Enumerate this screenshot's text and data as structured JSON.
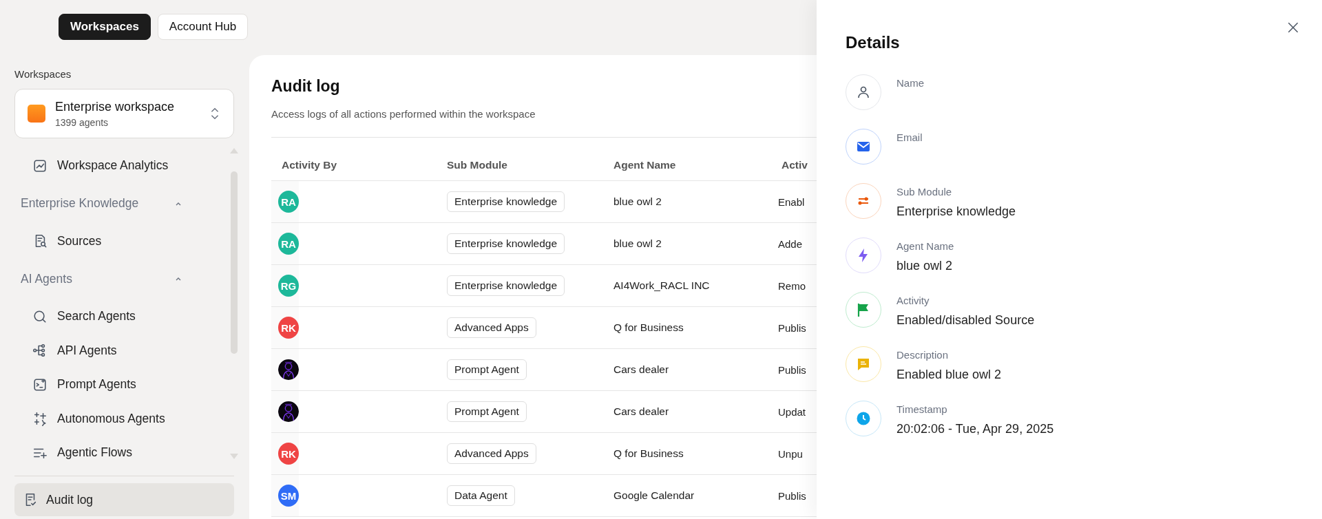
{
  "top_tabs": [
    {
      "label": "Workspaces",
      "selected": true
    },
    {
      "label": "Account Hub",
      "selected": false
    }
  ],
  "sidebar": {
    "section_label": "Workspaces",
    "workspace": {
      "name": "Enterprise workspace",
      "count": "1399 agents"
    },
    "nav": [
      {
        "kind": "item",
        "label": "Workspace Analytics"
      },
      {
        "kind": "section",
        "label": "Enterprise Knowledge",
        "expanded": true,
        "children": [
          {
            "kind": "item",
            "label": "Sources"
          }
        ]
      },
      {
        "kind": "section",
        "label": "AI Agents",
        "expanded": true,
        "children": [
          {
            "kind": "item",
            "label": "Search Agents"
          },
          {
            "kind": "item",
            "label": "API Agents"
          },
          {
            "kind": "item",
            "label": "Prompt Agents"
          },
          {
            "kind": "item",
            "label": "Autonomous Agents"
          },
          {
            "kind": "item",
            "label": "Agentic Flows"
          }
        ]
      }
    ],
    "footer_item": {
      "label": "Audit log",
      "selected": true
    }
  },
  "audit": {
    "title": "Audit log",
    "subtitle": "Access logs of all actions performed within the workspace",
    "columns": [
      "Activity By",
      "Sub Module",
      "Agent Name",
      "Activ"
    ],
    "rows": [
      {
        "avatar": {
          "kind": "initials",
          "initials": "RA",
          "color": "#1db89a"
        },
        "sub_module": "Enterprise knowledge",
        "agent_name": "blue owl 2",
        "activity": "Enabl"
      },
      {
        "avatar": {
          "kind": "initials",
          "initials": "RA",
          "color": "#1db89a"
        },
        "sub_module": "Enterprise knowledge",
        "agent_name": "blue owl 2",
        "activity": "Adde"
      },
      {
        "avatar": {
          "kind": "initials",
          "initials": "RG",
          "color": "#1db89a"
        },
        "sub_module": "Enterprise knowledge",
        "agent_name": "AI4Work_RACL INC",
        "activity": "Remo"
      },
      {
        "avatar": {
          "kind": "initials",
          "initials": "RK",
          "color": "#ef4444"
        },
        "sub_module": "Advanced Apps",
        "agent_name": "Q for Business",
        "activity": "Publis"
      },
      {
        "sub_module": "Prompt Agent",
        "agent_name": "Cars dealer",
        "activity": "Publis"
      },
      {
        "sub_module": "Prompt Agent",
        "agent_name": "Cars dealer",
        "activity": "Updat"
      },
      {
        "avatar": {
          "kind": "initials",
          "initials": "RK",
          "color": "#ef4444"
        },
        "sub_module": "Advanced Apps",
        "agent_name": "Q for Business",
        "activity": "Unpu"
      },
      {
        "avatar": {
          "kind": "initials",
          "initials": "SM",
          "color": "#2f6cf6"
        },
        "sub_module": "Data Agent",
        "agent_name": "Google Calendar",
        "activity": "Publis"
      }
    ]
  },
  "details": {
    "title": "Details",
    "fields": [
      {
        "label": "Name"
      },
      {
        "label": "Email"
      },
      {
        "label": "Sub Module",
        "value": "Enterprise knowledge"
      },
      {
        "label": "Agent Name",
        "value": "blue owl 2"
      },
      {
        "label": "Activity",
        "value": "Enabled/disabled Source"
      },
      {
        "label": "Description",
        "value": "Enabled blue owl 2"
      },
      {
        "label": "Timestamp",
        "value": "20:02:06 - Tue, Apr 29, 2025"
      }
    ]
  }
}
